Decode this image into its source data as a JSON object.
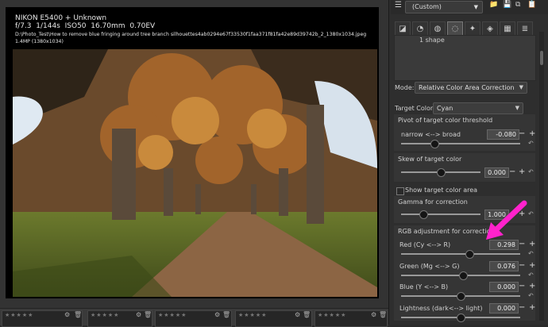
{
  "info": {
    "camera": "NIKON E5400 + Unknown",
    "exposure_f": "f/7.3",
    "exposure_s": "1/144s",
    "iso": "ISO50",
    "focal": "16.70mm",
    "ev": "0.70EV",
    "filename": "D:\\Photo_Test\\How to remove blue fringing around tree branch silhouettes4ab0294e67f33530f1faa371f81fa42e89d39742b_2_1380x1034.jpeg",
    "size": "1.4MP (1380x1034)"
  },
  "profile": {
    "selected": "(Custom)"
  },
  "shapes": {
    "label": "1 shape"
  },
  "mode": {
    "label": "Mode:",
    "value": "Relative Color Area Correction"
  },
  "target": {
    "label": "Target Color:",
    "value": "Cyan"
  },
  "pivot": {
    "title": "Pivot of target color threshold",
    "label": "narrow <--> broad",
    "value": "-0.080",
    "level": 0.28
  },
  "skew": {
    "title": "Skew of target color",
    "value": "0.000",
    "level": 0.5
  },
  "show_area": {
    "label": "Show target color area"
  },
  "gamma": {
    "title": "Gamma for correction",
    "value": "1.000",
    "level": 0.28
  },
  "rgb": {
    "title": "RGB adjustment for correction",
    "red": {
      "label": "Red (Cy <--> R)",
      "value": "0.298",
      "level": 0.57
    },
    "green": {
      "label": "Green (Mg <--> G)",
      "value": "0.076",
      "level": 0.52
    },
    "blue": {
      "label": "Blue  (Y <--> B)",
      "value": "0.000",
      "level": 0.5
    },
    "lightness": {
      "label": "Lightness (dark<--> light)",
      "value": "0.000",
      "level": 0.5
    }
  },
  "filmstrip": {
    "stars": "★★★★★"
  },
  "colors": {
    "arrow": "#ff22cc",
    "panel_bg": "#2e2e2e"
  }
}
